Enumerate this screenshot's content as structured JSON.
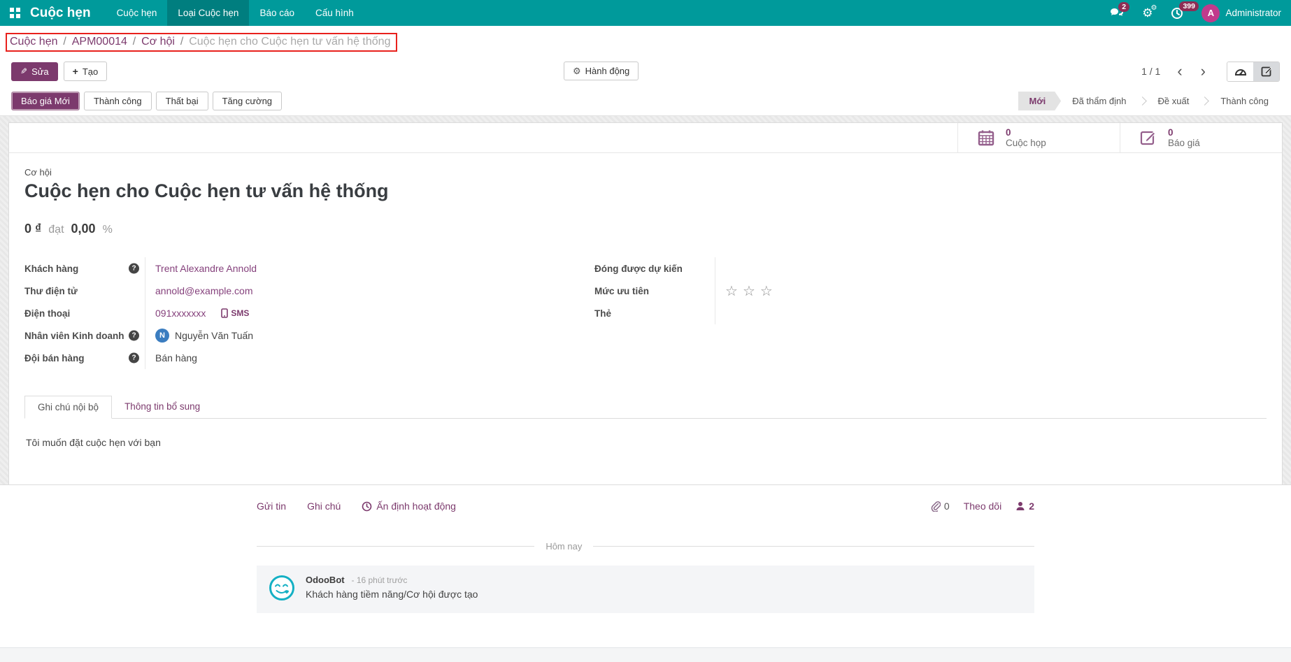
{
  "colors": {
    "primary_teal": "#009a9b",
    "brand_purple": "#7c3a6d",
    "link_purple": "#85417c",
    "annotation_red": "#e8211d",
    "badge_maroon": "#8e2d55",
    "avatar_magenta": "#c13a8c",
    "avatar_blue": "#3b7dc0",
    "odoobot_teal": "#14b0c4"
  },
  "nav": {
    "brand": "Cuộc hẹn",
    "items": [
      {
        "label": "Cuộc hẹn"
      },
      {
        "label": "Loại Cuộc hẹn"
      },
      {
        "label": "Báo cáo"
      },
      {
        "label": "Cấu hình"
      }
    ],
    "messages_badge": "2",
    "activities_badge": "399",
    "user": {
      "initial": "A",
      "name": "Administrator"
    }
  },
  "breadcrumb": {
    "separator": "/",
    "links": [
      {
        "label": "Cuộc hẹn"
      },
      {
        "label": "APM00014"
      },
      {
        "label": "Cơ hội"
      }
    ],
    "current": "Cuộc hẹn cho Cuộc hẹn tư vấn hệ thống"
  },
  "toolbar": {
    "edit_label": "Sửa",
    "create_label": "Tạo",
    "action_label": "Hành động",
    "pager": "1 / 1"
  },
  "statusbar": {
    "buttons": [
      {
        "label": "Báo giá Mới"
      },
      {
        "label": "Thành công"
      },
      {
        "label": "Thất bại"
      },
      {
        "label": "Tăng cường"
      }
    ],
    "stages": [
      {
        "label": "Mới"
      },
      {
        "label": "Đã thẩm định"
      },
      {
        "label": "Đề xuất"
      },
      {
        "label": "Thành công"
      }
    ]
  },
  "stat_buttons": [
    {
      "icon": "calendar-icon",
      "value": "0",
      "label": "Cuộc họp"
    },
    {
      "icon": "quotation-icon",
      "value": "0",
      "label": "Báo giá"
    }
  ],
  "sheet": {
    "record_type": "Cơ hội",
    "title": "Cuộc hẹn cho Cuộc hẹn tư vấn hệ thống",
    "revenue": {
      "amount": "0",
      "currency": "₫",
      "connector": "đạt",
      "probability": "0,00",
      "unit": "%"
    },
    "left_fields": {
      "customer": {
        "label": "Khách hàng",
        "value": "Trent Alexandre Annold"
      },
      "email": {
        "label": "Thư điện tử",
        "value": "annold@example.com"
      },
      "phone": {
        "label": "Điện thoại",
        "value": "091xxxxxxx",
        "sms": "SMS"
      },
      "salesperson": {
        "label": "Nhân viên Kinh doanh",
        "value": "Nguyễn Văn Tuấn",
        "avatar_initial": "N"
      },
      "sales_team": {
        "label": "Đội bán hàng",
        "value": "Bán hàng"
      }
    },
    "right_fields": {
      "expected_closing": {
        "label": "Đóng được dự kiến",
        "value": ""
      },
      "priority": {
        "label": "Mức ưu tiên",
        "stars": 3
      },
      "tags": {
        "label": "Thẻ",
        "value": ""
      }
    },
    "tabs": [
      {
        "label": "Ghi chú nội bộ"
      },
      {
        "label": "Thông tin bổ sung"
      }
    ],
    "note": "Tôi muốn đặt cuộc hẹn với bạn"
  },
  "chatter": {
    "send_label": "Gửi tin",
    "log_label": "Ghi chú",
    "activity_label": "Ấn định hoạt động",
    "attachment_count": "0",
    "follow_label": "Theo dõi",
    "follower_count": "2",
    "date_divider": "Hôm nay",
    "messages": [
      {
        "author": "OdooBot",
        "time": "- 16 phút trước",
        "body": "Khách hàng tiềm năng/Cơ hội được tạo"
      }
    ]
  }
}
